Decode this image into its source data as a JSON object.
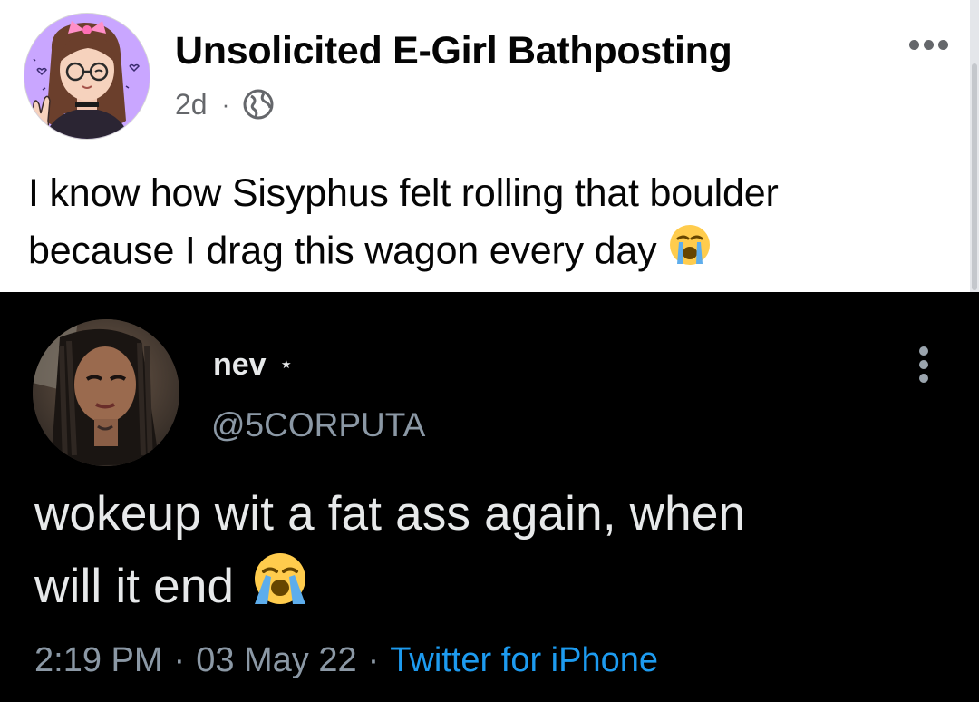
{
  "colors": {
    "fb_background": "#ffffff",
    "tweet_background": "#000000",
    "twitter_blue": "#1d9bf0",
    "muted_gray": "#65676b"
  },
  "fb_post": {
    "author": "Unsolicited E-Girl Bathposting",
    "time": "2d",
    "dot": "·",
    "audience_icon": "globe-icon",
    "more_icon": "more-horizontal-icon",
    "text_line1": "I know how Sisyphus felt rolling that boulder",
    "text_line2": "because I drag this wagon every day",
    "emoji": "loudly-crying-face"
  },
  "tweet": {
    "name": "nev",
    "star": "⋆",
    "handle": "@5CORPUTA",
    "more_icon": "more-vertical-icon",
    "text_line1": "wokeup wit a fat ass again, when",
    "text_line2": "will it end",
    "emoji": "loudly-crying-face",
    "time": "2:19 PM",
    "sep1": "·",
    "date": "03 May 22",
    "sep2": "·",
    "source": "Twitter for iPhone"
  }
}
